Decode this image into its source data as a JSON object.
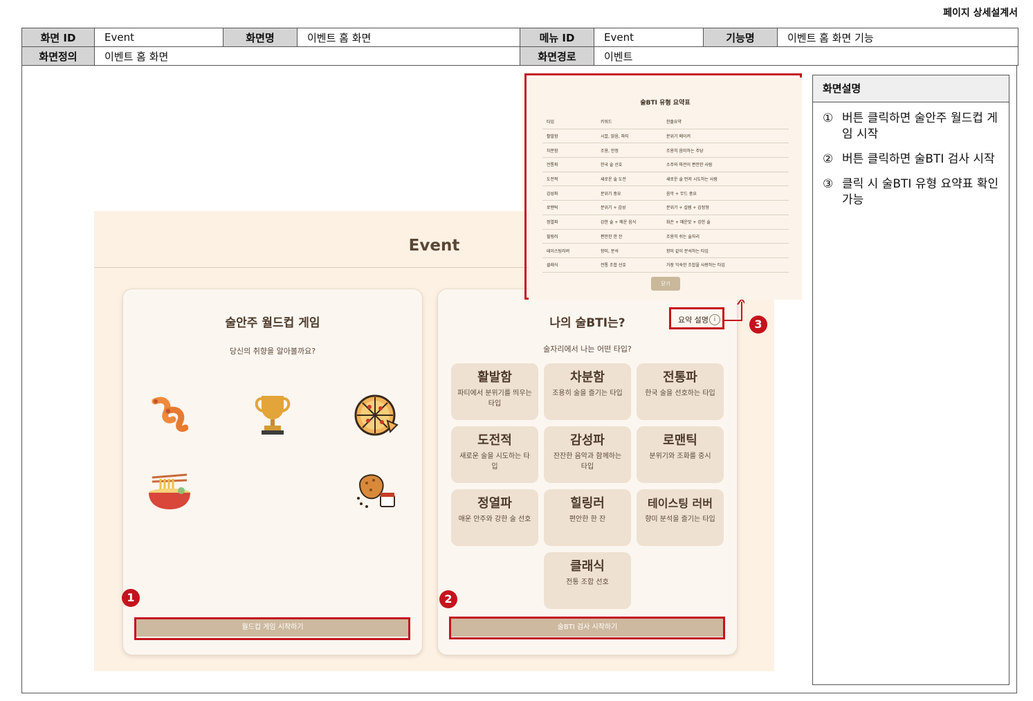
{
  "doc": {
    "title": "페이지 상세설계서",
    "meta": {
      "screen_id_label": "화면 ID",
      "screen_id": "Event",
      "screen_name_label": "화면명",
      "screen_name": "이벤트 홈 화면",
      "menu_id_label": "메뉴 ID",
      "menu_id": "Event",
      "function_name_label": "기능명",
      "function_name": "이벤트 홈 화면 기능",
      "screen_def_label": "화면정의",
      "screen_def": "이벤트 홈 화면",
      "screen_path_label": "화면경로",
      "screen_path": "이벤트"
    }
  },
  "description": {
    "header": "화면설명",
    "items": [
      {
        "num": "①",
        "text": "버튼 클릭하면 술안주 월드컵 게임 시작"
      },
      {
        "num": "②",
        "text": "버튼 클릭하면 술BTI 검사 시작"
      },
      {
        "num": "③",
        "text": "클릭 시 술BTI 유형 요약표 확인 가능"
      }
    ]
  },
  "app": {
    "title": "Event",
    "worldcup": {
      "title": "술안주 월드컵 게임",
      "subtitle": "당신의 취향을 알아볼까요?",
      "icons": [
        "shrimp-icon",
        "trophy-icon",
        "pizza-icon",
        "ramen-icon",
        "fried-chicken-icon"
      ],
      "button": "월드컵 게임 시작하기"
    },
    "bti": {
      "title": "나의 술BTI는?",
      "summary_link": "요약 설명",
      "subtitle": "술자리에서 나는 어떤 타입?",
      "types": [
        {
          "name": "활발함",
          "desc": "파티에서 분위기를 띄우는 타입"
        },
        {
          "name": "차분함",
          "desc": "조용히 술을 즐기는 타입"
        },
        {
          "name": "전통파",
          "desc": "한국 술을 선호하는 타입"
        },
        {
          "name": "도전적",
          "desc": "새로운 술을 시도하는 타입"
        },
        {
          "name": "감성파",
          "desc": "잔잔한 음악과 함께하는 타입"
        },
        {
          "name": "로맨틱",
          "desc": "분위기와 조화를 중시"
        },
        {
          "name": "정열파",
          "desc": "매운 안주와 강한 술 선호"
        },
        {
          "name": "힐링러",
          "desc": "편안한 한 잔"
        },
        {
          "name": "테이스팅 러버",
          "desc": "향미 분석을 즐기는 타입"
        },
        {
          "name": "클래식",
          "desc": "전통 조합 선호"
        }
      ],
      "button": "술BTI 검사 시작하기"
    },
    "summary_popup": {
      "title": "술BTI 유형 요약표",
      "headers": [
        "타입",
        "키워드",
        "한줄요약"
      ],
      "rows": [
        [
          "활발함",
          "시끌, 밝음, 파티",
          "분위기 메이커"
        ],
        [
          "차분함",
          "조용, 안정",
          "조용히 음미하는 주당"
        ],
        [
          "전통파",
          "한국 술 선호",
          "소주와 파전이 편안한 사람"
        ],
        [
          "도전적",
          "새로운 술 도전",
          "새로운 술 먼저 시도하는 사람"
        ],
        [
          "감성파",
          "분위기 중요",
          "음악 + 무드 중요"
        ],
        [
          "로맨틱",
          "분위기 + 감성",
          "분위기 + 설렘 + 감정형"
        ],
        [
          "정열파",
          "강한 술 + 매운 음식",
          "화끈 + 매운맛 + 강한 술"
        ],
        [
          "힐링러",
          "편안한 한 잔",
          "조용히 쉬는 술자리"
        ],
        [
          "테이스팅러버",
          "향미, 분석",
          "향미 같이 분석하는 타입"
        ],
        [
          "클래식",
          "전통 조합 선호",
          "가장 익숙한 조합을 사랑하는 타입"
        ]
      ],
      "close": "닫기"
    }
  },
  "annotations": [
    "1",
    "2",
    "3"
  ],
  "colors": {
    "highlight": "#c5131d",
    "app_bg": "#fcf1e3",
    "button": "#cdb99f",
    "tile": "#eee1d1"
  }
}
